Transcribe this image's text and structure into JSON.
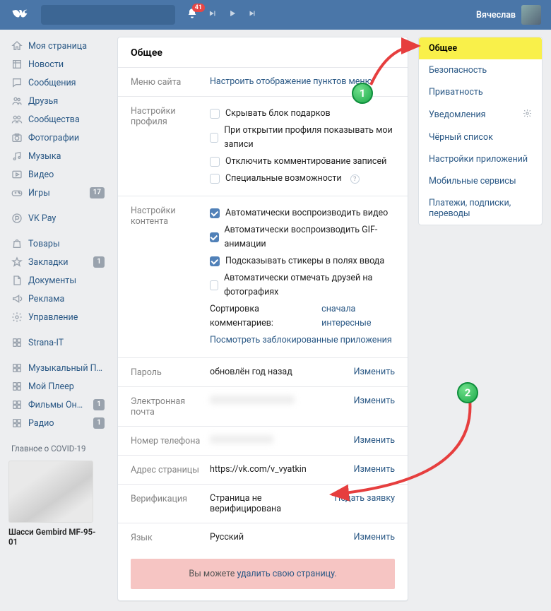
{
  "header": {
    "notif_count": "41",
    "username": "Вячеслав"
  },
  "sidebar": {
    "items": [
      {
        "icon": "home",
        "label": "Моя страница",
        "badge": ""
      },
      {
        "icon": "news",
        "label": "Новости",
        "badge": ""
      },
      {
        "icon": "msg",
        "label": "Сообщения",
        "badge": ""
      },
      {
        "icon": "friends",
        "label": "Друзья",
        "badge": ""
      },
      {
        "icon": "groups",
        "label": "Сообщества",
        "badge": ""
      },
      {
        "icon": "photo",
        "label": "Фотографии",
        "badge": ""
      },
      {
        "icon": "music",
        "label": "Музыка",
        "badge": ""
      },
      {
        "icon": "video",
        "label": "Видео",
        "badge": ""
      },
      {
        "icon": "game",
        "label": "Игры",
        "badge": "17"
      }
    ],
    "items2": [
      {
        "icon": "pay",
        "label": "VK Pay",
        "badge": ""
      }
    ],
    "items3": [
      {
        "icon": "bag",
        "label": "Товары",
        "badge": ""
      },
      {
        "icon": "star",
        "label": "Закладки",
        "badge": "1"
      },
      {
        "icon": "doc",
        "label": "Документы",
        "badge": ""
      },
      {
        "icon": "ad",
        "label": "Реклама",
        "badge": ""
      },
      {
        "icon": "gear",
        "label": "Управление",
        "badge": ""
      }
    ],
    "items4": [
      {
        "icon": "app",
        "label": "Strana-IT",
        "badge": ""
      }
    ],
    "items5": [
      {
        "icon": "app",
        "label": "Музыкальный Плее…",
        "badge": ""
      },
      {
        "icon": "app",
        "label": "Мой Плеер",
        "badge": ""
      },
      {
        "icon": "app",
        "label": "Фильмы Онлайн",
        "badge": "1"
      },
      {
        "icon": "app",
        "label": "Радио",
        "badge": "1"
      }
    ],
    "covid": "Главное о COVID-19",
    "ad_title": "Шасси Gembird MF-95-01"
  },
  "main": {
    "title": "Общее",
    "menu_site": {
      "label": "Меню сайта",
      "value": "Настроить отображение пунктов меню"
    },
    "profile": {
      "label": "Настройки профиля",
      "opts": [
        {
          "text": "Скрывать блок подарков",
          "checked": false
        },
        {
          "text": "При открытии профиля показывать мои записи",
          "checked": false
        },
        {
          "text": "Отключить комментирование записей",
          "checked": false
        },
        {
          "text": "Специальные возможности",
          "checked": false,
          "help": true
        }
      ]
    },
    "content": {
      "label": "Настройки контента",
      "opts": [
        {
          "text": "Автоматически воспроизводить видео",
          "checked": true
        },
        {
          "text": "Автоматически воспроизводить GIF-анимации",
          "checked": true
        },
        {
          "text": "Подсказывать стикеры в полях ввода",
          "checked": true
        },
        {
          "text": "Автоматически отмечать друзей на фотографиях",
          "checked": false
        }
      ],
      "sort_label": "Сортировка комментариев:",
      "sort_value": "сначала интересные",
      "blocked_link": "Посмотреть заблокированные приложения"
    },
    "password": {
      "label": "Пароль",
      "value": "обновлён год назад",
      "action": "Изменить"
    },
    "email": {
      "label": "Электронная почта",
      "action": "Изменить"
    },
    "phone": {
      "label": "Номер телефона",
      "action": "Изменить"
    },
    "address": {
      "label": "Адрес страницы",
      "value": "https://vk.com/v_vyatkin",
      "action": "Изменить"
    },
    "verification": {
      "label": "Верификация",
      "value": "Страница не верифицирована",
      "action": "Подать заявку"
    },
    "lang": {
      "label": "Язык",
      "value": "Русский",
      "action": "Изменить"
    },
    "delete_prefix": "Вы можете ",
    "delete_link": "удалить свою страницу."
  },
  "rightnav": {
    "items": [
      {
        "label": "Общее",
        "active": true
      },
      {
        "label": "Безопасность"
      },
      {
        "label": "Приватность"
      },
      {
        "label": "Уведомления",
        "gear": true
      },
      {
        "label": "Чёрный список"
      },
      {
        "label": "Настройки приложений"
      },
      {
        "label": "Мобильные сервисы"
      },
      {
        "label": "Платежи, подписки, переводы"
      }
    ]
  },
  "anno": {
    "c1": "1",
    "c2": "2"
  }
}
